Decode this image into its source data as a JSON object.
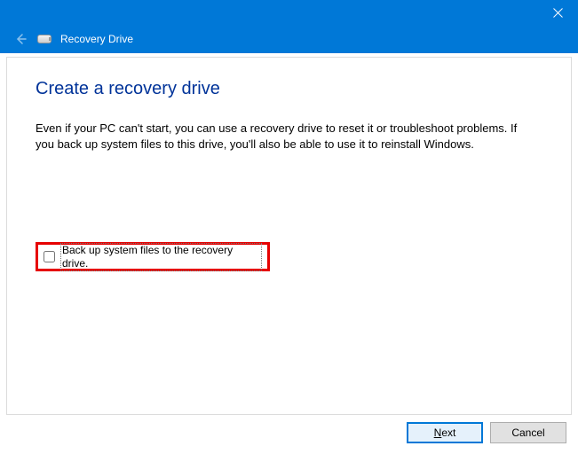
{
  "colors": {
    "accent": "#0078d7",
    "title": "#003399",
    "highlight": "#e60000"
  },
  "titlebar": {
    "close_name": "close-icon"
  },
  "header": {
    "back_name": "back-icon",
    "icon_name": "recovery-drive-icon",
    "title": "Recovery Drive"
  },
  "page": {
    "title": "Create a recovery drive",
    "description": "Even if your PC can't start, you can use a recovery drive to reset it or troubleshoot problems. If you back up system files to this drive, you'll also be able to use it to reinstall Windows."
  },
  "option": {
    "checked": false,
    "label": "Back up system files to the recovery drive."
  },
  "footer": {
    "next_prefix": "N",
    "next_rest": "ext",
    "cancel": "Cancel"
  }
}
